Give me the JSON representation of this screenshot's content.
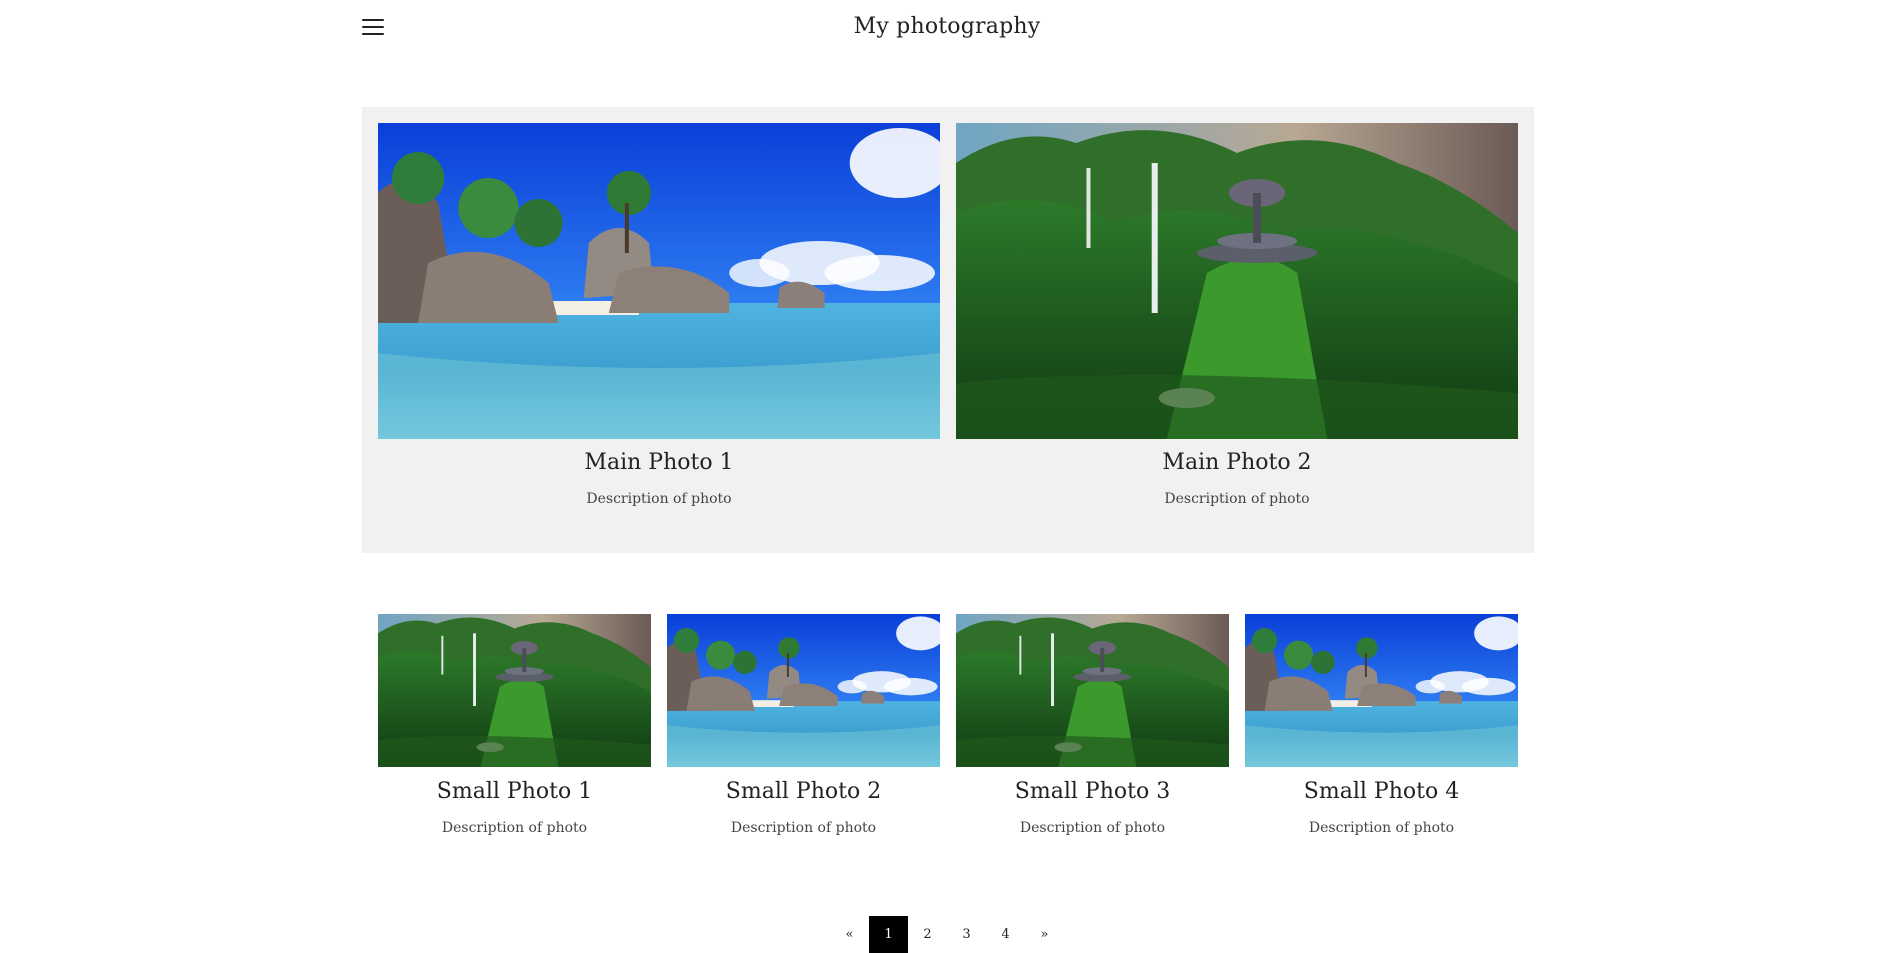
{
  "header": {
    "menu_icon": "hamburger-menu-icon",
    "title": "My photography"
  },
  "featured": [
    {
      "title": "Main Photo 1",
      "description": "Description of photo",
      "scene": "tropical-beach"
    },
    {
      "title": "Main Photo 2",
      "description": "Description of photo",
      "scene": "green-mountain-futuristic-house"
    }
  ],
  "gallery": [
    {
      "title": "Small Photo 1",
      "description": "Description of photo",
      "scene": "green-mountain-futuristic-house"
    },
    {
      "title": "Small Photo 2",
      "description": "Description of photo",
      "scene": "tropical-beach"
    },
    {
      "title": "Small Photo 3",
      "description": "Description of photo",
      "scene": "green-mountain-futuristic-house"
    },
    {
      "title": "Small Photo 4",
      "description": "Description of photo",
      "scene": "tropical-beach"
    }
  ],
  "pagination": {
    "prev": "«",
    "pages": [
      "1",
      "2",
      "3",
      "4"
    ],
    "current": "1",
    "next": "»"
  },
  "colors": {
    "featured_background": "#f1f1f1",
    "active_page": "#000000"
  }
}
